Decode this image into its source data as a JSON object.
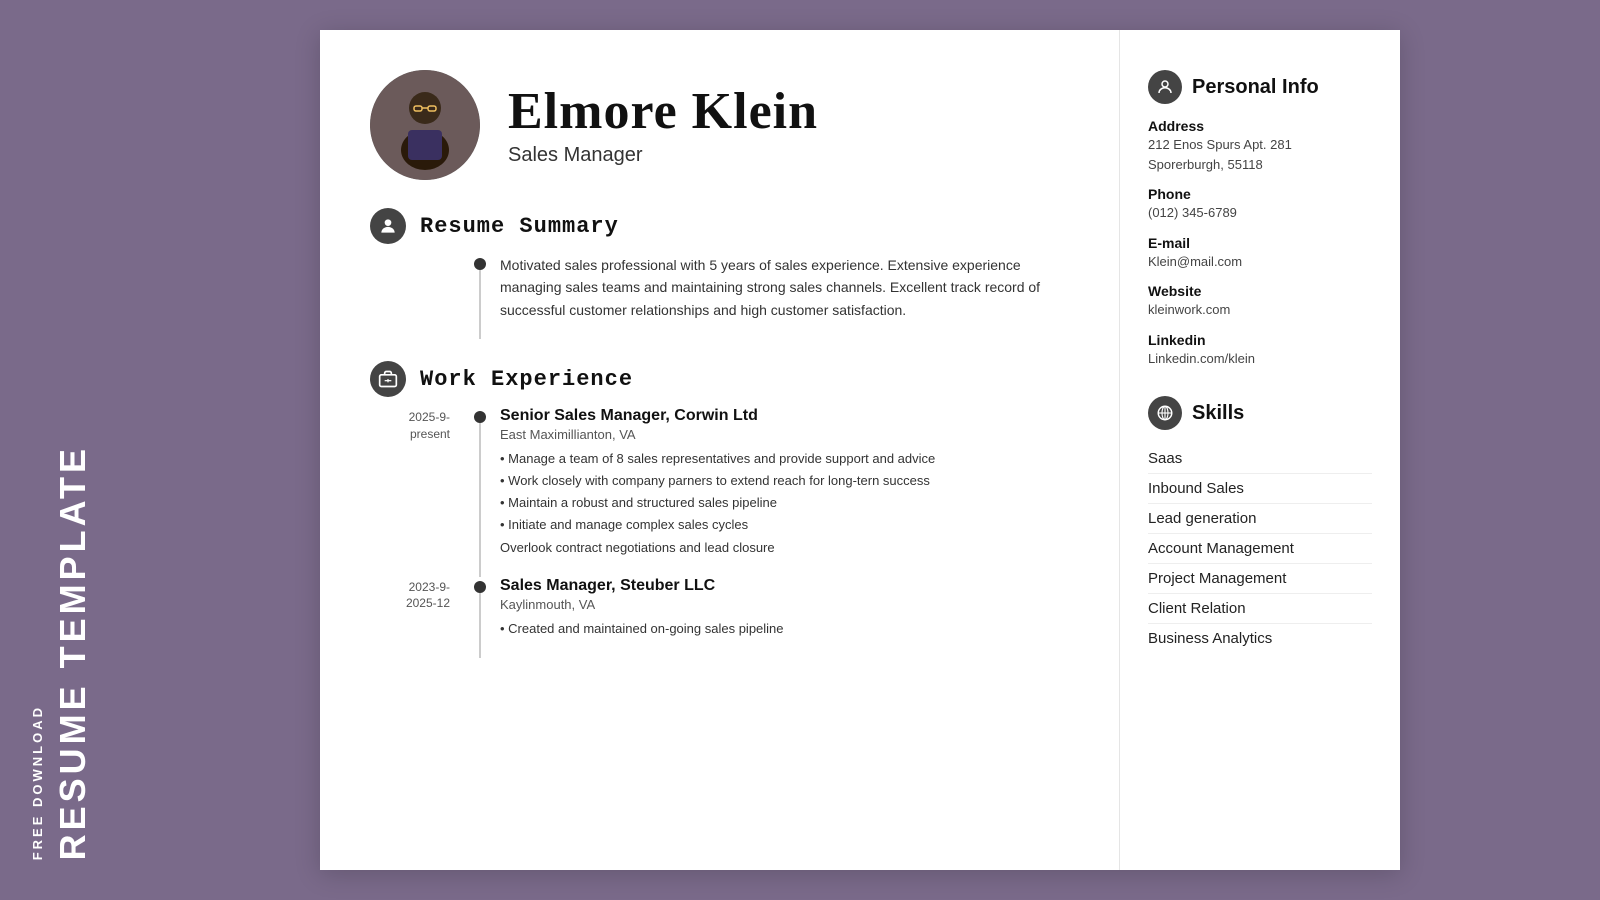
{
  "watermark": {
    "free_download": "FREE DOWNLOAD",
    "resume_template": "RESUME TEMPLATE"
  },
  "header": {
    "name": "Elmore Klein",
    "title": "Sales Manager"
  },
  "summary": {
    "section_title": "Resume Summary",
    "text": "Motivated sales professional with 5 years of sales experience. Extensive experience managing sales teams and maintaining strong sales channels. Excellent track record of successful customer relationships and high customer satisfaction."
  },
  "work_experience": {
    "section_title": "Work Experience",
    "jobs": [
      {
        "title": "Senior Sales Manager, Corwin Ltd",
        "location": "East Maximillianton, VA",
        "date_start": "2025-9-",
        "date_end": "present",
        "bullets": [
          "• Manage a team of 8 sales representatives and provide support and advice",
          "• Work closely with company parners to extend reach for long-tern success",
          "• Maintain a robust and structured sales pipeline",
          "• Initiate and manage complex sales cycles",
          "Overlook contract negotiations and lead closure"
        ]
      },
      {
        "title": "Sales Manager, Steuber LLC",
        "location": "Kaylinmouth, VA",
        "date_start": "2023-9-",
        "date_end": "2025-12",
        "bullets": [
          "• Created and maintained on-going sales pipeline"
        ]
      }
    ]
  },
  "personal_info": {
    "section_title": "Personal Info",
    "address_label": "Address",
    "address_line1": "212 Enos Spurs Apt. 281",
    "address_line2": "Sporerburgh, 55118",
    "phone_label": "Phone",
    "phone": "(012) 345-6789",
    "email_label": "E-mail",
    "email": "Klein@mail.com",
    "website_label": "Website",
    "website": "kleinwork.com",
    "linkedin_label": "Linkedin",
    "linkedin": "Linkedin.com/klein"
  },
  "skills": {
    "section_title": "Skills",
    "items": [
      "Saas",
      "Inbound Sales",
      "Lead generation",
      "Account Management",
      "Project Management",
      "Client Relation",
      "Business Analytics"
    ]
  }
}
